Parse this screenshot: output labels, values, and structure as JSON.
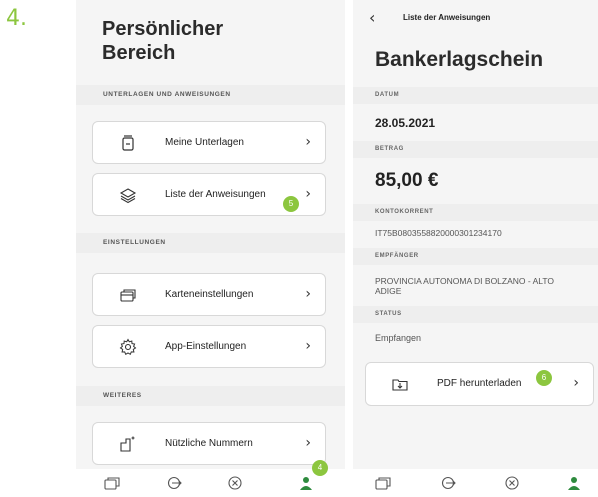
{
  "step_number": "4.",
  "left_screen": {
    "title": "Persönlicher Bereich",
    "sections": [
      {
        "label": "UNTERLAGEN UND ANWEISUNGEN"
      },
      {
        "label": "EINSTELLUNGEN"
      },
      {
        "label": "WEITERES"
      }
    ],
    "items": [
      {
        "label": "Meine Unterlagen",
        "icon": "document-box-icon"
      },
      {
        "label": "Liste der Anweisungen",
        "icon": "layers-icon",
        "badge": "5"
      },
      {
        "label": "Karteneinstellungen",
        "icon": "cards-icon"
      },
      {
        "label": "App-Einstellungen",
        "icon": "gear-icon"
      },
      {
        "label": "Nützliche Nummern",
        "icon": "phone-sparkle-icon"
      }
    ],
    "tabbar_badge": "4"
  },
  "right_screen": {
    "nav_title": "Liste der Anweisungen",
    "title": "Bankerlagschein",
    "fields": {
      "datum_label": "DATUM",
      "datum": "28.05.2021",
      "betrag_label": "BETRAG",
      "betrag": "85,00 €",
      "konto_label": "KONTOKORRENT",
      "konto": "IT75B0803558820000301234170",
      "empf_label": "EMPFÄNGER",
      "empf": "PROVINCIA AUTONOMA DI BOLZANO - ALTO ADIGE",
      "status_label": "STATUS",
      "status": "Empfangen"
    },
    "pdf_button": "PDF herunterladen",
    "pdf_badge": "6"
  },
  "tabs": [
    "cards-tab-icon",
    "transfer-tab-icon",
    "close-circle-tab-icon",
    "profile-tab-icon"
  ],
  "accent_color": "#8cc63f"
}
